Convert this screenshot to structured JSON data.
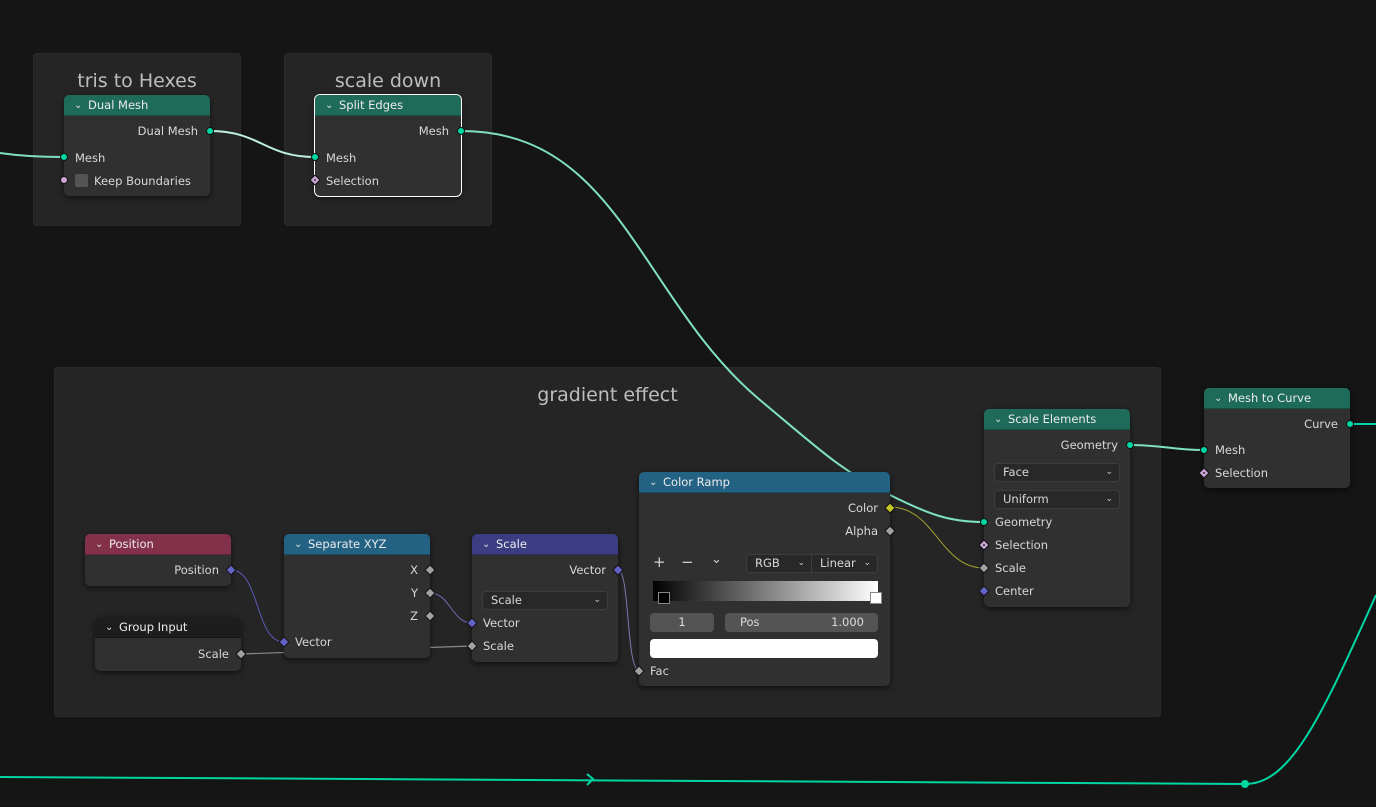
{
  "frames": [
    {
      "id": "tris",
      "label": "tris to Hexes"
    },
    {
      "id": "scale",
      "label": "scale down"
    },
    {
      "id": "gradient",
      "label": "gradient effect"
    }
  ],
  "nodes": {
    "dual_mesh": {
      "title": "Dual Mesh",
      "header_color": "#1e6b5a",
      "outputs": [
        "Dual Mesh"
      ],
      "inputs": [
        "Mesh",
        "Keep Boundaries"
      ],
      "keep_boundaries": false
    },
    "split_edges": {
      "title": "Split Edges",
      "header_color": "#1e6b5a",
      "selected": true,
      "outputs": [
        "Mesh"
      ],
      "inputs": [
        "Mesh",
        "Selection"
      ]
    },
    "position": {
      "title": "Position",
      "header_color": "#83314a",
      "outputs": [
        "Position"
      ]
    },
    "group_input": {
      "title": "Group Input",
      "header_color": "#1d1d1d",
      "outputs": [
        "Scale"
      ]
    },
    "separate_xyz": {
      "title": "Separate XYZ",
      "header_color": "#246283",
      "outputs": [
        "X",
        "Y",
        "Z"
      ],
      "inputs": [
        "Vector"
      ]
    },
    "vector_scale": {
      "title": "Scale",
      "header_color": "#3c3c83",
      "outputs": [
        "Vector"
      ],
      "operation": "Scale",
      "inputs": [
        "Vector",
        "Scale"
      ]
    },
    "color_ramp": {
      "title": "Color Ramp",
      "header_color": "#246283",
      "outputs": [
        "Color",
        "Alpha"
      ],
      "add_icon": "+",
      "remove_icon": "−",
      "menu_icon": "⌄",
      "color_mode": "RGB",
      "interpolation": "Linear",
      "active_stop_index": "1",
      "pos_label": "Pos",
      "pos_value": "1.000",
      "stops": [
        {
          "position": 0.0,
          "color": "#000000"
        },
        {
          "position": 1.0,
          "color": "#ffffff"
        }
      ],
      "active_color": "#ffffff",
      "inputs": [
        "Fac"
      ]
    },
    "scale_elements": {
      "title": "Scale Elements",
      "header_color": "#1e6b5a",
      "outputs": [
        "Geometry"
      ],
      "domain": "Face",
      "scale_mode": "Uniform",
      "inputs": [
        "Geometry",
        "Selection",
        "Scale",
        "Center"
      ]
    },
    "mesh_to_curve": {
      "title": "Mesh to Curve",
      "header_color": "#1e6b5a",
      "outputs": [
        "Curve"
      ],
      "inputs": [
        "Mesh",
        "Selection"
      ]
    }
  },
  "colors": {
    "geometry_socket": "#00d6a3",
    "vector_socket": "#6363c7",
    "float_socket": "#a1a1a1",
    "color_socket": "#c7c729",
    "boolean_socket": "#cca6d6",
    "link_geometry": "#7fe0c4"
  }
}
